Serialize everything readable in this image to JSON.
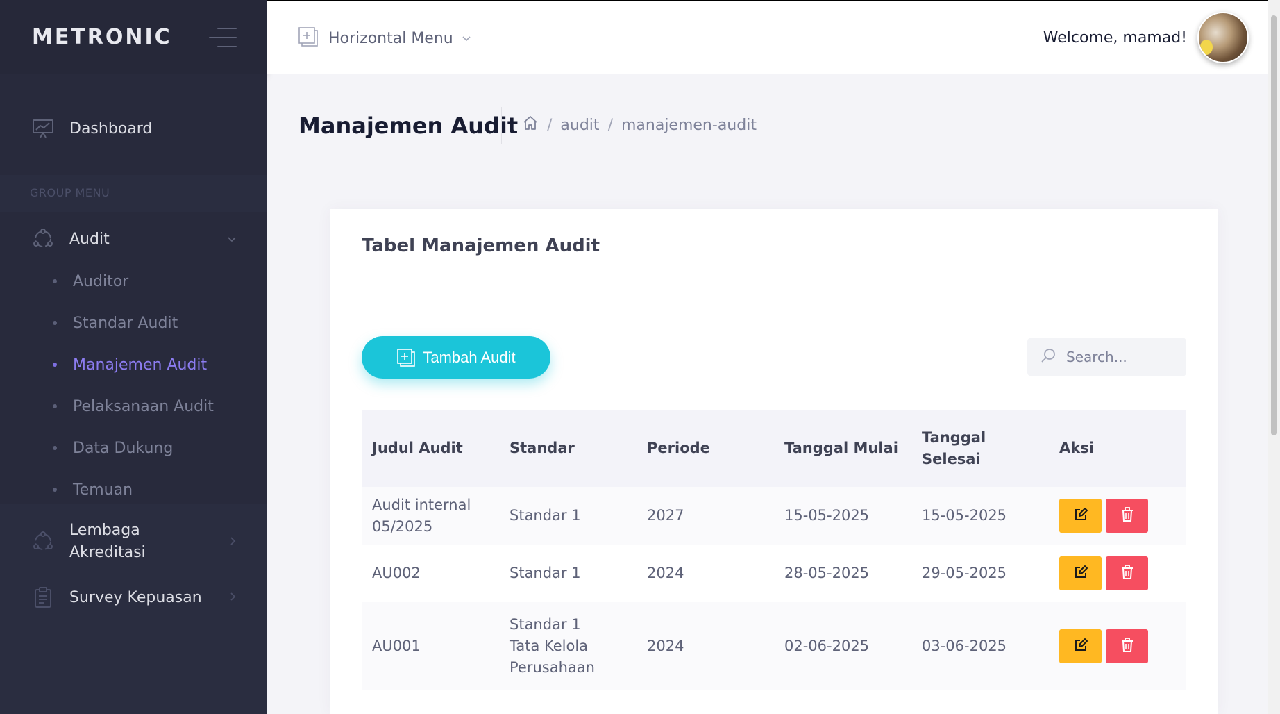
{
  "app": {
    "brand": "METRONIC"
  },
  "sidebar": {
    "dashboard_label": "Dashboard",
    "group_title": "GROUP MENU",
    "audit": {
      "label": "Audit",
      "children": [
        "Auditor",
        "Standar Audit",
        "Manajemen Audit",
        "Pelaksanaan Audit",
        "Data Dukung",
        "Temuan"
      ],
      "active_child": "Manajemen Audit"
    },
    "lembaga": {
      "label_line1": "Lembaga",
      "label_line2": "Akreditasi"
    },
    "survey": {
      "label": "Survey Kepuasan"
    }
  },
  "header": {
    "horizontal_menu": "Horizontal Menu",
    "welcome": "Welcome, mamad!"
  },
  "subheader": {
    "title": "Manajemen Audit",
    "breadcrumb": [
      "audit",
      "manajemen-audit"
    ],
    "sep": "/"
  },
  "card": {
    "title": "Tabel Manajemen Audit",
    "add_button": "Tambah Audit",
    "search_placeholder": "Search..."
  },
  "table": {
    "headers": {
      "judul": "Judul Audit",
      "standar": "Standar",
      "periode": "Periode",
      "mulai": "Tanggal Mulai",
      "selesai_line1": "Tanggal",
      "selesai_line2": "Selesai",
      "aksi": "Aksi"
    },
    "rows": [
      {
        "judul_l1": "Audit internal",
        "judul_l2": "05/2025",
        "standar_l1": "Standar 1",
        "periode": "2027",
        "mulai": "15-05-2025",
        "selesai": "15-05-2025"
      },
      {
        "judul_l1": "AU002",
        "standar_l1": "Standar 1",
        "periode": "2024",
        "mulai": "28-05-2025",
        "selesai": "29-05-2025"
      },
      {
        "judul_l1": "AU001",
        "standar_l1": "Standar 1",
        "standar_l2": "Tata Kelola",
        "standar_l3": "Perusahaan",
        "periode": "2024",
        "mulai": "02-06-2025",
        "selesai": "03-06-2025"
      }
    ]
  },
  "colors": {
    "sidebar_bg": "#2a2d40",
    "accent_active": "#8c7cf0",
    "add_button": "#1bc5d9",
    "edit_button": "#ffb822",
    "delete_button": "#f64e60"
  },
  "icons": [
    "menu-toggle-icon",
    "dashboard-chart-icon",
    "audit-cycle-icon",
    "chevron-down-icon",
    "chevron-right-icon",
    "clipboard-icon",
    "horizontal-menu-icon",
    "home-icon",
    "add-box-icon",
    "search-icon",
    "edit-icon",
    "trash-icon"
  ]
}
